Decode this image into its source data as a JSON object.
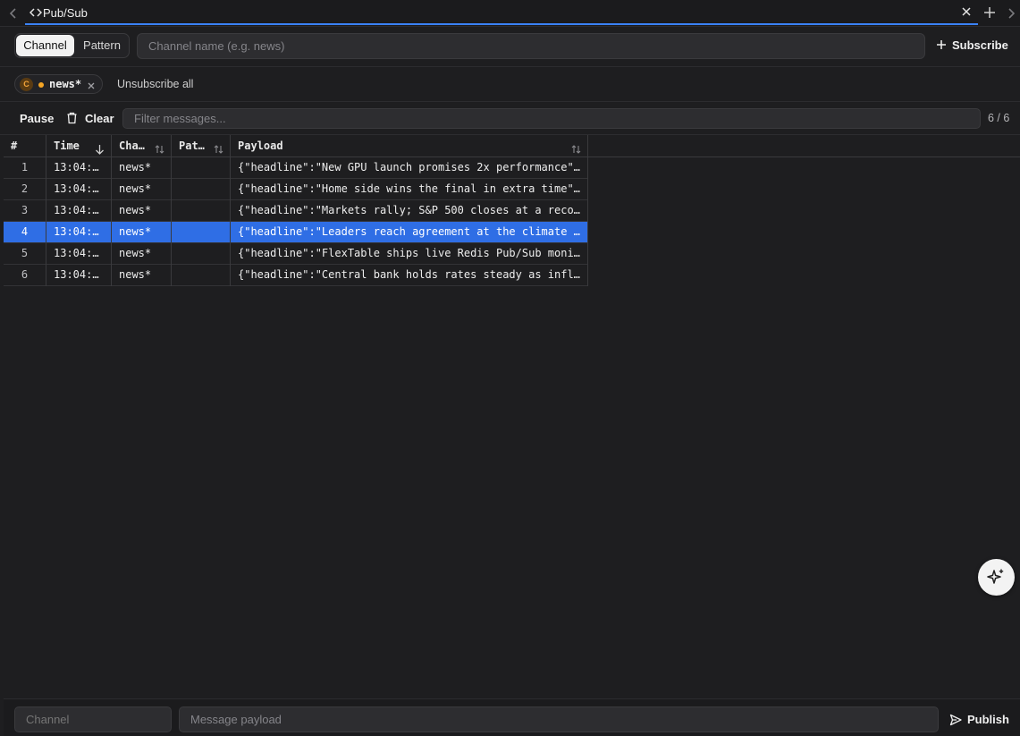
{
  "tab": {
    "title": "Pub/Sub",
    "icon": "code-brackets-icon"
  },
  "subscribe": {
    "modes": [
      "Channel",
      "Pattern"
    ],
    "active_mode": "Channel",
    "channel_placeholder": "Channel name (e.g. news)",
    "button_label": "Subscribe"
  },
  "subscriptions": {
    "chips": [
      {
        "badge": "C",
        "label": "news*",
        "status_color": "#f5a524"
      }
    ],
    "unsubscribe_all_label": "Unsubscribe all"
  },
  "toolbar": {
    "pause_label": "Pause",
    "clear_label": "Clear",
    "filter_placeholder": "Filter messages...",
    "count": "6 / 6"
  },
  "table": {
    "columns": [
      "#",
      "Time",
      "Cha…",
      "Pat…",
      "Payload"
    ],
    "rows": [
      {
        "num": "1",
        "time": "13:04:…",
        "channel": "news*",
        "pattern": "",
        "payload": "{\"headline\":\"New GPU launch promises 2x performance\"…"
      },
      {
        "num": "2",
        "time": "13:04:…",
        "channel": "news*",
        "pattern": "",
        "payload": "{\"headline\":\"Home side wins the final in extra time\"…"
      },
      {
        "num": "3",
        "time": "13:04:…",
        "channel": "news*",
        "pattern": "",
        "payload": "{\"headline\":\"Markets rally; S&P 500 closes at a reco…"
      },
      {
        "num": "4",
        "time": "13:04:…",
        "channel": "news*",
        "pattern": "",
        "payload": "{\"headline\":\"Leaders reach agreement at the climate …"
      },
      {
        "num": "5",
        "time": "13:04:…",
        "channel": "news*",
        "pattern": "",
        "payload": "{\"headline\":\"FlexTable ships live Redis Pub/Sub moni…"
      },
      {
        "num": "6",
        "time": "13:04:…",
        "channel": "news*",
        "pattern": "",
        "payload": "{\"headline\":\"Central bank holds rates steady as infl…"
      }
    ],
    "selected_row": 4
  },
  "publish": {
    "channel_placeholder": "Channel",
    "payload_placeholder": "Message payload",
    "button_label": "Publish"
  },
  "colors": {
    "accent": "#3b82f6",
    "selected_row": "#2f6ee5",
    "background": "#1e1e20"
  }
}
